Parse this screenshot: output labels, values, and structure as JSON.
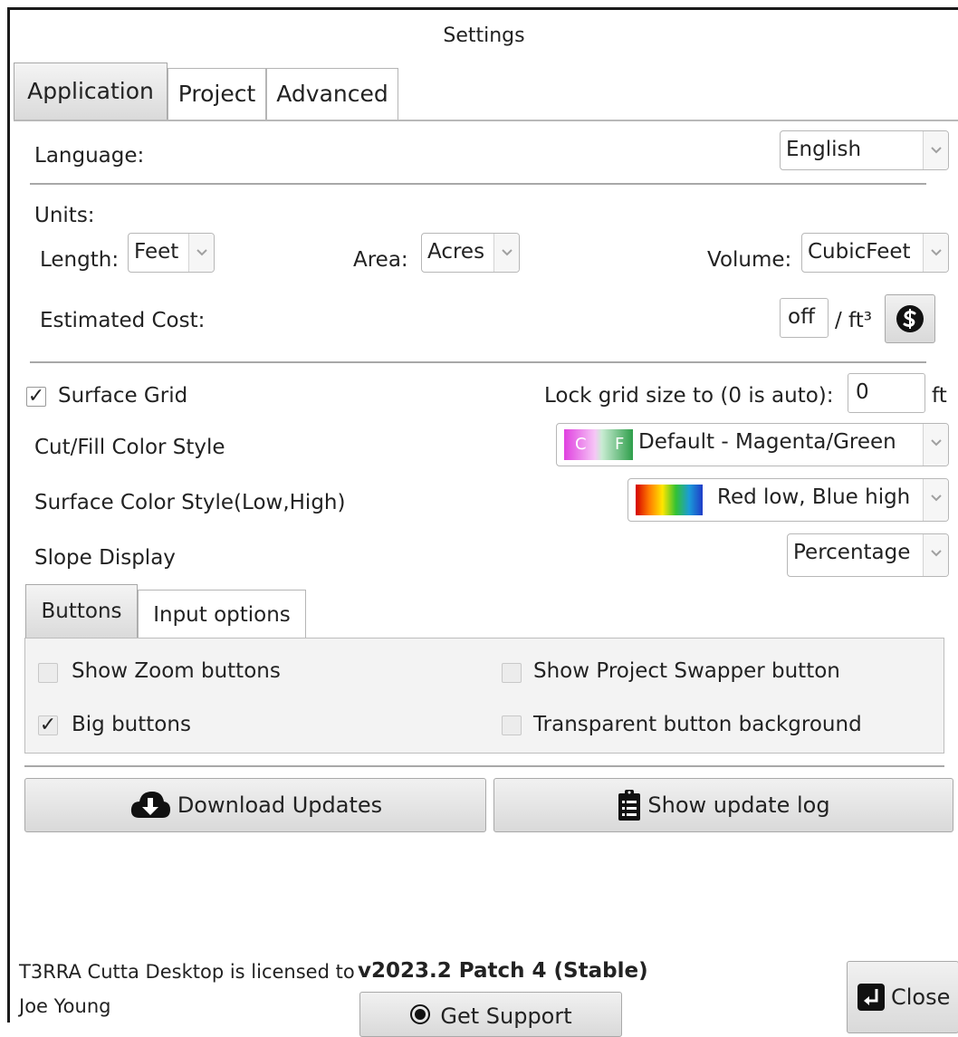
{
  "window": {
    "title": "Settings"
  },
  "tabs": [
    {
      "label": "Application"
    },
    {
      "label": "Project"
    },
    {
      "label": "Advanced"
    }
  ],
  "language": {
    "label": "Language:",
    "value": "English"
  },
  "units": {
    "heading": "Units:",
    "length_label": "Length:",
    "length_value": "Feet",
    "area_label": "Area:",
    "area_value": "Acres",
    "volume_label": "Volume:",
    "volume_value": "CubicFeet"
  },
  "cost": {
    "label": "Estimated Cost:",
    "value": "off",
    "unit": "/ ft³",
    "currency_icon": "dollar-coin-icon"
  },
  "surface_grid": {
    "label": "Surface Grid",
    "checked": true,
    "lock_label": "Lock grid size to (0 is auto):",
    "lock_value": "0",
    "lock_unit": "ft"
  },
  "cutfill": {
    "label": "Cut/Fill Color Style",
    "swatch_cut": "C",
    "swatch_fill": "F",
    "value": "Default - Magenta/Green",
    "colors": {
      "cut": "#e040e0",
      "fill": "#2e9e4a"
    }
  },
  "surface_color": {
    "label": "Surface Color Style(Low,High)",
    "value": "Red low, Blue high"
  },
  "slope": {
    "label": "Slope Display",
    "value": "Percentage"
  },
  "subtabs": [
    {
      "label": "Buttons"
    },
    {
      "label": "Input options"
    }
  ],
  "options": {
    "show_zoom": {
      "label": "Show Zoom buttons",
      "checked": false
    },
    "big_buttons": {
      "label": "Big buttons",
      "checked": true
    },
    "show_swapper": {
      "label": "Show Project Swapper button",
      "checked": false
    },
    "transparent_bg": {
      "label": "Transparent button background",
      "checked": false
    }
  },
  "actions": {
    "download": "Download Updates",
    "update_log": "Show update log"
  },
  "footer": {
    "license_line": "T3RRA Cutta Desktop is licensed to",
    "licensee": "Joe Young",
    "version": "v2023.2 Patch 4 (Stable)",
    "support": "Get Support",
    "close": "Close"
  }
}
